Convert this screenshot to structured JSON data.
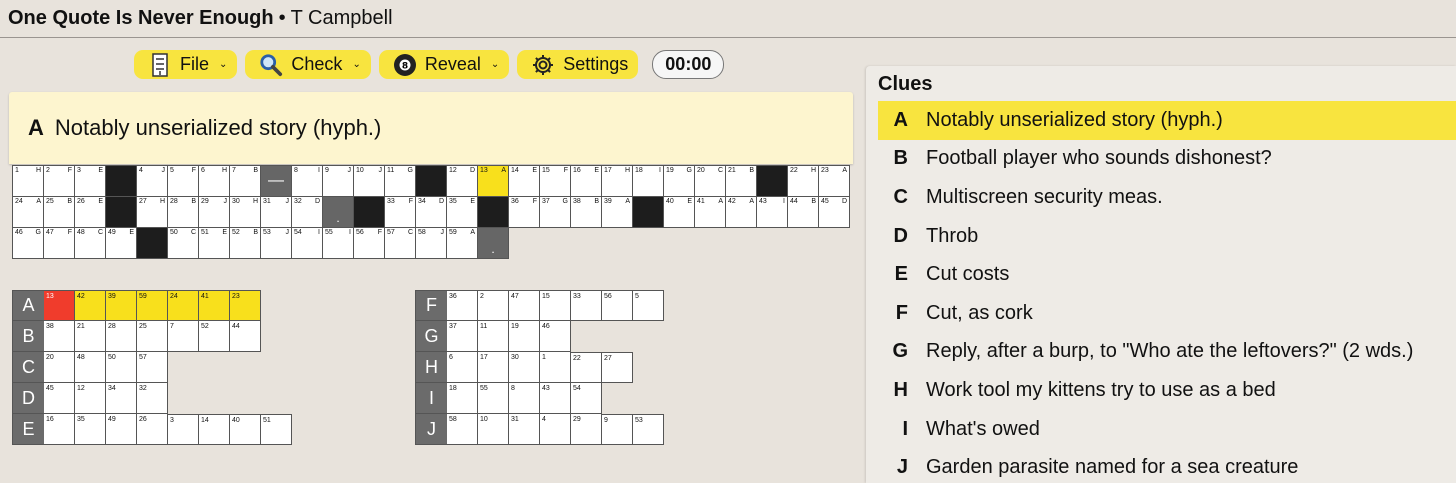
{
  "title": {
    "name": "One Quote Is Never Enough",
    "separator": "•",
    "author": "T Campbell"
  },
  "toolbar": {
    "file_label": "File",
    "check_label": "Check",
    "reveal_label": "Reveal",
    "settings_label": "Settings",
    "timer": "00:00",
    "caret": "⌄"
  },
  "current_clue": {
    "letter": "A",
    "text": "Notably unserialized story (hyph.)"
  },
  "clues_heading": "Clues",
  "clues": [
    {
      "letter": "A",
      "text": "Notably unserialized story (hyph.)",
      "active": true
    },
    {
      "letter": "B",
      "text": "Football player who sounds dishonest?"
    },
    {
      "letter": "C",
      "text": "Multiscreen security meas."
    },
    {
      "letter": "D",
      "text": "Throb"
    },
    {
      "letter": "E",
      "text": "Cut costs"
    },
    {
      "letter": "F",
      "text": "Cut, as cork"
    },
    {
      "letter": "G",
      "text": "Reply, after a burp, to \"Who ate the leftovers?\" (2 wds.)"
    },
    {
      "letter": "H",
      "text": "Work tool my kittens try to use as a bed"
    },
    {
      "letter": "I",
      "text": "What's owed"
    },
    {
      "letter": "J",
      "text": "Garden parasite named for a sea creature"
    }
  ],
  "quote_grid": [
    [
      {
        "n": "1",
        "l": "H"
      },
      {
        "n": "2",
        "l": "F"
      },
      {
        "n": "3",
        "l": "E"
      },
      {
        "t": "black"
      },
      {
        "n": "4",
        "l": "J"
      },
      {
        "n": "5",
        "l": "F"
      },
      {
        "n": "6",
        "l": "H"
      },
      {
        "n": "7",
        "l": "B"
      },
      {
        "t": "gray",
        "m": "—"
      },
      {
        "n": "8",
        "l": "I"
      },
      {
        "n": "9",
        "l": "J"
      },
      {
        "n": "10",
        "l": "J"
      },
      {
        "n": "11",
        "l": "G"
      },
      {
        "t": "black"
      },
      {
        "n": "12",
        "l": "D"
      },
      {
        "n": "13",
        "l": "A",
        "hl": true
      },
      {
        "n": "14",
        "l": "E"
      },
      {
        "n": "15",
        "l": "F"
      },
      {
        "n": "16",
        "l": "E"
      },
      {
        "n": "17",
        "l": "H"
      },
      {
        "n": "18",
        "l": "I"
      },
      {
        "n": "19",
        "l": "G"
      },
      {
        "n": "20",
        "l": "C"
      },
      {
        "n": "21",
        "l": "B"
      },
      {
        "t": "black"
      },
      {
        "n": "22",
        "l": "H"
      },
      {
        "n": "23",
        "l": "A"
      }
    ],
    [
      {
        "n": "24",
        "l": "A"
      },
      {
        "n": "25",
        "l": "B"
      },
      {
        "n": "26",
        "l": "E"
      },
      {
        "t": "black"
      },
      {
        "n": "27",
        "l": "H"
      },
      {
        "n": "28",
        "l": "B"
      },
      {
        "n": "29",
        "l": "J"
      },
      {
        "n": "30",
        "l": "H"
      },
      {
        "n": "31",
        "l": "J"
      },
      {
        "n": "32",
        "l": "D"
      },
      {
        "t": "gray",
        "m": "."
      },
      {
        "t": "black"
      },
      {
        "n": "33",
        "l": "F"
      },
      {
        "n": "34",
        "l": "D"
      },
      {
        "n": "35",
        "l": "E"
      },
      {
        "t": "black"
      },
      {
        "n": "36",
        "l": "F"
      },
      {
        "n": "37",
        "l": "G"
      },
      {
        "n": "38",
        "l": "B"
      },
      {
        "n": "39",
        "l": "A"
      },
      {
        "t": "black"
      },
      {
        "n": "40",
        "l": "E"
      },
      {
        "n": "41",
        "l": "A"
      },
      {
        "n": "42",
        "l": "A"
      },
      {
        "n": "43",
        "l": "I"
      },
      {
        "n": "44",
        "l": "B"
      },
      {
        "n": "45",
        "l": "D"
      }
    ],
    [
      {
        "n": "46",
        "l": "G"
      },
      {
        "n": "47",
        "l": "F"
      },
      {
        "n": "48",
        "l": "C"
      },
      {
        "n": "49",
        "l": "E"
      },
      {
        "t": "black"
      },
      {
        "n": "50",
        "l": "C"
      },
      {
        "n": "51",
        "l": "E"
      },
      {
        "n": "52",
        "l": "B"
      },
      {
        "n": "53",
        "l": "J"
      },
      {
        "n": "54",
        "l": "I"
      },
      {
        "n": "55",
        "l": "I"
      },
      {
        "n": "56",
        "l": "F"
      },
      {
        "n": "57",
        "l": "C"
      },
      {
        "n": "58",
        "l": "J"
      },
      {
        "n": "59",
        "l": "A"
      },
      {
        "t": "gray",
        "m": "."
      }
    ]
  ],
  "word_grids": {
    "left": [
      {
        "label": "A",
        "cells": [
          "13",
          "42",
          "39",
          "59",
          "24",
          "41",
          "23"
        ],
        "state": [
          "cur",
          "hl",
          "hl",
          "hl",
          "hl",
          "hl",
          "hl"
        ]
      },
      {
        "label": "B",
        "cells": [
          "38",
          "21",
          "28",
          "25",
          "7",
          "52",
          "44"
        ]
      },
      {
        "label": "C",
        "cells": [
          "20",
          "48",
          "50",
          "57"
        ]
      },
      {
        "label": "D",
        "cells": [
          "45",
          "12",
          "34",
          "32"
        ]
      },
      {
        "label": "E",
        "cells": [
          "16",
          "35",
          "49",
          "26",
          "3",
          "14",
          "40",
          "51"
        ]
      }
    ],
    "right": [
      {
        "label": "F",
        "cells": [
          "36",
          "2",
          "47",
          "15",
          "33",
          "56",
          "5"
        ]
      },
      {
        "label": "G",
        "cells": [
          "37",
          "11",
          "19",
          "46"
        ]
      },
      {
        "label": "H",
        "cells": [
          "6",
          "17",
          "30",
          "1",
          "22",
          "27"
        ]
      },
      {
        "label": "I",
        "cells": [
          "18",
          "55",
          "8",
          "43",
          "54"
        ]
      },
      {
        "label": "J",
        "cells": [
          "58",
          "10",
          "31",
          "4",
          "29",
          "9",
          "53"
        ]
      }
    ]
  },
  "colors": {
    "highlight": "#f8e01c",
    "current": "#f03c2c",
    "clue_bar": "#fdf5cf",
    "button": "#f8e43f"
  },
  "icons": {
    "file": "file-icon",
    "check": "magnifier-icon",
    "reveal": "eight-ball-icon",
    "settings": "gear-icon"
  }
}
